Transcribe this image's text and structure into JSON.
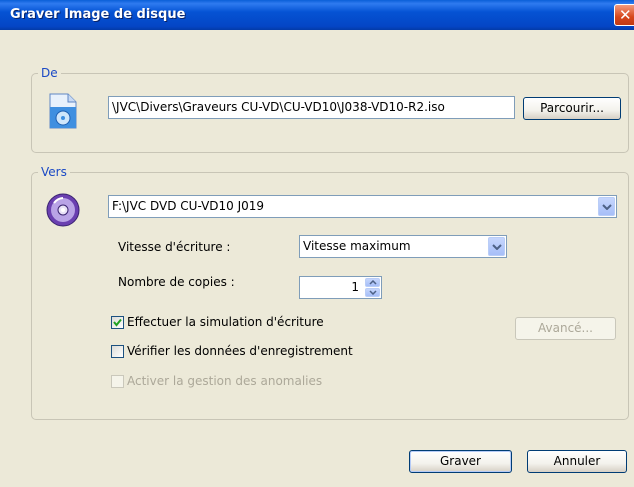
{
  "window": {
    "title": "Graver Image de disque"
  },
  "source": {
    "group_label": "De",
    "path": "\\JVC\\Divers\\Graveurs CU-VD\\CU-VD10\\J038-VD10-R2.iso",
    "browse_label": "Parcourir..."
  },
  "destination": {
    "group_label": "Vers",
    "drive": "F:\\JVC DVD CU-VD10 J019",
    "speed_label": "Vitesse d'écriture :",
    "speed_value": "Vitesse maximum",
    "copies_label": "Nombre de copies :",
    "copies_value": "1",
    "simulate_label": "Effectuer la simulation d'écriture",
    "simulate_checked": true,
    "advanced_label": "Avancé...",
    "verify_label": "Vérifier les données d'enregistrement",
    "verify_checked": false,
    "defect_label": "Activer la gestion des anomalies",
    "defect_checked": false
  },
  "footer": {
    "burn_label": "Graver",
    "cancel_label": "Annuler"
  },
  "icons": {
    "close": "close-icon",
    "image_file": "disc-image-file-icon",
    "disc": "disc-icon"
  },
  "colors": {
    "titlebar": "#0553d4",
    "group_label": "#1a49c5",
    "check": "#21a121"
  }
}
